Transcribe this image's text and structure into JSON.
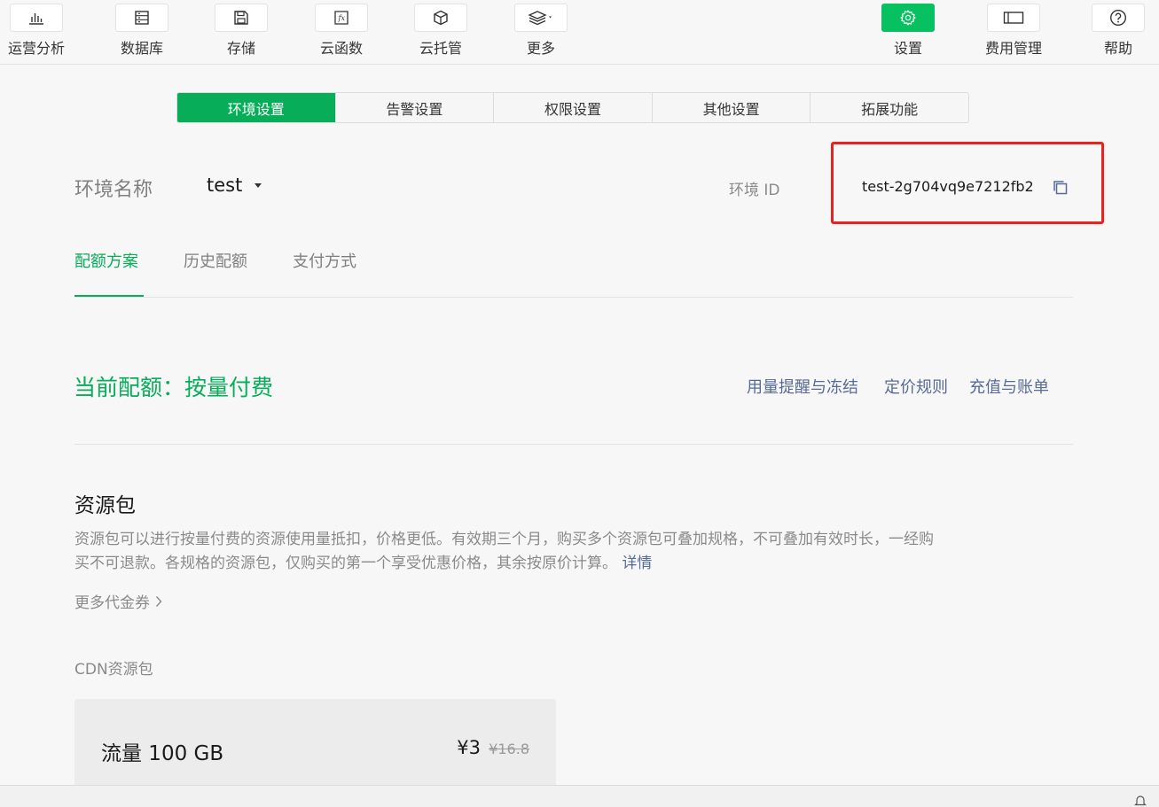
{
  "toolbar": {
    "items": [
      {
        "label": "运营分析",
        "icon": "bar-chart-icon"
      },
      {
        "label": "数据库",
        "icon": "database-icon"
      },
      {
        "label": "存储",
        "icon": "save-icon"
      },
      {
        "label": "云函数",
        "icon": "function-icon"
      },
      {
        "label": "云托管",
        "icon": "box-icon"
      },
      {
        "label": "更多",
        "icon": "layers-icon"
      },
      {
        "label": "设置",
        "icon": "gear-icon"
      },
      {
        "label": "费用管理",
        "icon": "wallet-icon"
      },
      {
        "label": "帮助",
        "icon": "help-icon"
      }
    ]
  },
  "tabs": [
    "环境设置",
    "告警设置",
    "权限设置",
    "其他设置",
    "拓展功能"
  ],
  "env": {
    "name_label": "环境名称",
    "name_value": "test",
    "id_label": "环境 ID",
    "id_value": "test-2g704vq9e7212fb2"
  },
  "subtabs": [
    "配额方案",
    "历史配额",
    "支付方式"
  ],
  "quota": {
    "title": "当前配额：按量付费",
    "links": [
      "用量提醒与冻结",
      "定价规则",
      "充值与账单"
    ]
  },
  "resource": {
    "title": "资源包",
    "desc_line1": "资源包可以进行按量付费的资源使用量抵扣，价格更低。有效期三个月，购买多个资源包可叠加规格，不可叠加有效时长，一经购",
    "desc_line2": "买不可退款。各规格的资源包，仅购买的第一个享受优惠价格，其余按原价计算。",
    "detail_link": "详情",
    "more_coupon": "更多代金券",
    "cdn_label": "CDN资源包",
    "card": {
      "name": "流量 100 GB",
      "price": "¥3",
      "original_price": "¥16.8"
    }
  },
  "colors": {
    "accent": "#07ad58",
    "link": "#576b95",
    "highlight": "#e8231d"
  }
}
